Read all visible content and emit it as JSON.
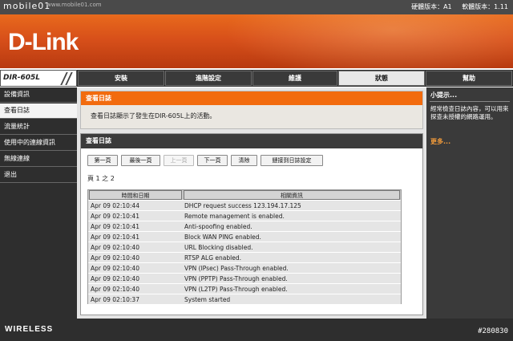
{
  "watermark": {
    "text": "mobile01",
    "sub": "www.mobile01.com"
  },
  "versions": {
    "hw": "硬體版本：A1",
    "fw": "軟體版本：1.11"
  },
  "brand": {
    "logo": "D-Link",
    "model": "DIR-605L",
    "footer": "WIRELESS"
  },
  "tabs": [
    "安裝",
    "進階設定",
    "維護",
    "狀態",
    "幫助"
  ],
  "active_tab": "狀態",
  "menu": [
    "設備資訊",
    "查看日誌",
    "流量統計",
    "使用中的連線資訊",
    "無線連線",
    "退出"
  ],
  "active_menu": "查看日誌",
  "panel1": {
    "title": "查看日誌",
    "description": "查看日誌顯示了發生在DIR-605L上的活動。"
  },
  "panel2": {
    "title": "查看日誌",
    "buttons": [
      "第一頁",
      "最後一頁",
      "上一頁",
      "下一頁",
      "清除",
      "鏈接到日誌設定"
    ],
    "page_info": "頁 1 之 2",
    "columns": [
      "時間和日期",
      "相關資訊"
    ],
    "rows": [
      {
        "time": "Apr 09 02:10:44",
        "info": "DHCP request success 123.194.17.125"
      },
      {
        "time": "Apr 09 02:10:41",
        "info": "Remote management is enabled."
      },
      {
        "time": "Apr 09 02:10:41",
        "info": "Anti-spoofing enabled."
      },
      {
        "time": "Apr 09 02:10:41",
        "info": "Block WAN PING enabled."
      },
      {
        "time": "Apr 09 02:10:40",
        "info": "URL Blocking disabled."
      },
      {
        "time": "Apr 09 02:10:40",
        "info": "RTSP ALG enabled."
      },
      {
        "time": "Apr 09 02:10:40",
        "info": "VPN (IPsec) Pass-Through enabled."
      },
      {
        "time": "Apr 09 02:10:40",
        "info": "VPN (PPTP) Pass-Through enabled."
      },
      {
        "time": "Apr 09 02:10:40",
        "info": "VPN (L2TP) Pass-Through enabled."
      },
      {
        "time": "Apr 09 02:10:37",
        "info": "System started"
      }
    ]
  },
  "help": {
    "title": "小提示...",
    "text": "經常檢查日誌內容，可以用來探查未授權的網路運用。",
    "more": "更多..."
  },
  "ref": "#280830"
}
